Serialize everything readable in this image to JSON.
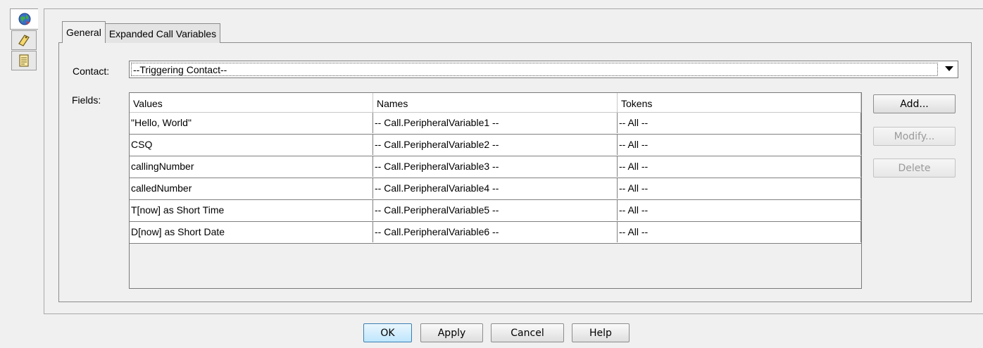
{
  "side_tabs": [
    {
      "icon": "globe-icon"
    },
    {
      "icon": "tag-icon"
    },
    {
      "icon": "notes-icon"
    }
  ],
  "tabs": [
    {
      "label": "General"
    },
    {
      "label": "Expanded Call Variables"
    }
  ],
  "contact": {
    "label": "Contact:",
    "value": "--Triggering Contact--"
  },
  "fields": {
    "label": "Fields:",
    "columns": [
      "Values",
      "Names",
      "Tokens"
    ],
    "rows": [
      [
        "\"Hello, World\"",
        "-- Call.PeripheralVariable1 --",
        "-- All --"
      ],
      [
        "CSQ",
        "-- Call.PeripheralVariable2 --",
        "-- All --"
      ],
      [
        "callingNumber",
        "-- Call.PeripheralVariable3 --",
        "-- All --"
      ],
      [
        "calledNumber",
        "-- Call.PeripheralVariable4 --",
        "-- All --"
      ],
      [
        "T[now] as Short Time",
        "-- Call.PeripheralVariable5 --",
        "-- All --"
      ],
      [
        "D[now] as Short Date",
        "-- Call.PeripheralVariable6 --",
        "-- All --"
      ]
    ]
  },
  "side_buttons": {
    "add": "Add...",
    "modify": "Modify...",
    "delete": "Delete"
  },
  "footer_buttons": {
    "ok": "OK",
    "apply": "Apply",
    "cancel": "Cancel",
    "help": "Help"
  }
}
